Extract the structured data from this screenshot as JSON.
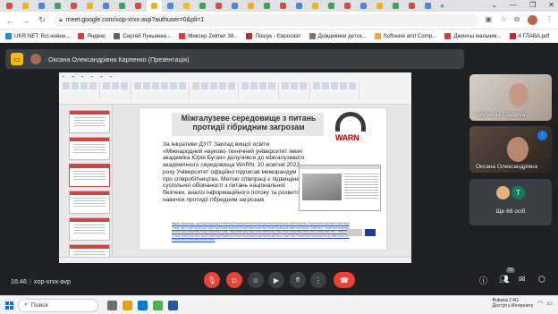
{
  "browser": {
    "tab_favicon_colors": [
      "#e8453c",
      "#f4b400",
      "#4285f4",
      "#34a853",
      "#e8453c",
      "#f4b400",
      "#4285f4",
      "#34a853",
      "#e8453c",
      "#f4b400",
      "#4285f4",
      "#fbbc04",
      "#34a853",
      "#e8453c",
      "#4285f4",
      "#f4b400",
      "#34a853",
      "#e8453c",
      "#4285f4",
      "#f4b400",
      "#34a853",
      "#e8453c",
      "#4285f4",
      "#f4b400",
      "#34a853",
      "#e8453c",
      "#4285f4"
    ],
    "active_tab_index": 9,
    "url": "meet.google.com/xop-xrxx-avp?authuser=0&pli=1",
    "window_controls": [
      "⌄",
      "—",
      "❐",
      "✕"
    ],
    "bookmarks": [
      {
        "label": "UKR.NET: Всі новин...",
        "color": "#1e88e5"
      },
      {
        "label": "Яндекс",
        "color": "#e53935"
      },
      {
        "label": "Сергей Лукьянен...",
        "color": "#616161"
      },
      {
        "label": "Миксер Zelmer 38...",
        "color": "#e53935"
      },
      {
        "label": "Пошук - Євросват",
        "color": "#c62828"
      },
      {
        "label": "Дождевики детск...",
        "color": "#8d6e63"
      },
      {
        "label": "Software and Comp...",
        "color": "#f9a825"
      },
      {
        "label": "Джинсы мальчик...",
        "color": "#e53935"
      },
      {
        "label": "4 ГЛАВА.pdf",
        "color": "#c62828"
      }
    ]
  },
  "meet": {
    "presentation_label": "Оксана Олександрівна Карпенко (Презентація)",
    "slide": {
      "title": "Міжгалузеве середовище з питань протидії гібридним загрозам",
      "logo_text": "WARN",
      "body": "За ініціативи ДУІТ Заклад вищої освіти «Міжнародний науково-технічний університет імені академіка Юрія Бугая» долучився до міжгалузевого академічного середовища WARN. 20 жовтня 2022 року Університет офіційно підписав меморандум про співробітництво. Метою співпраці є підвищення суспільної обізнаності з питань національної безпеки, аналіз інформаційного потоку та розвиток навичок протидії гібридним загрозам.",
      "link": "https://duiv.edu.ua/%d0%bc%d1%96%d0%b6%d0%b3%d0%b0%d0%bb%d1%83%d0%b7%d0%b5%d0%b2%d0%b5-%d1%81%d0%b5%d1%80%d0%b5%d0%b4%d0%be%d0%b2%d0%b8%d1%89%d0%b5-%d0%b7-%d0%bf%d0%b8%d1%82%d0%b0%d0%bd%d1%8c-%d0%bf%d1%80%d0%be%d1%82%d0%b8%d0%b4%d1%96%d1%97-%d0%b3%d1%96%d0%b1%d1%80%d0%b8%d0%b4%d0%bd%d0%b8%d0%bc-%d0%b7%d0%b0%d0%b3%d1%80%d0%be%d0%b7%d0%b0%d0%bc/"
    },
    "participants": [
      {
        "name": "Yevheniia Osypova"
      },
      {
        "name": "Оксана Олександрівна"
      }
    ],
    "others": {
      "initial": "T",
      "label": "Ще 68 осіб"
    },
    "time": "16:46",
    "meeting_code": "xop-xrxx-avp",
    "people_count": "71",
    "controls": [
      "mic-off-icon",
      "camera-off-icon",
      "emoji-icon",
      "present-icon",
      "raise-hand-icon",
      "more-icon",
      "end-call-icon"
    ]
  },
  "taskbar": {
    "search_placeholder": "Поиск",
    "network_name": "Bubuka 2.4G",
    "network_status": "Доступ к Интернету"
  }
}
